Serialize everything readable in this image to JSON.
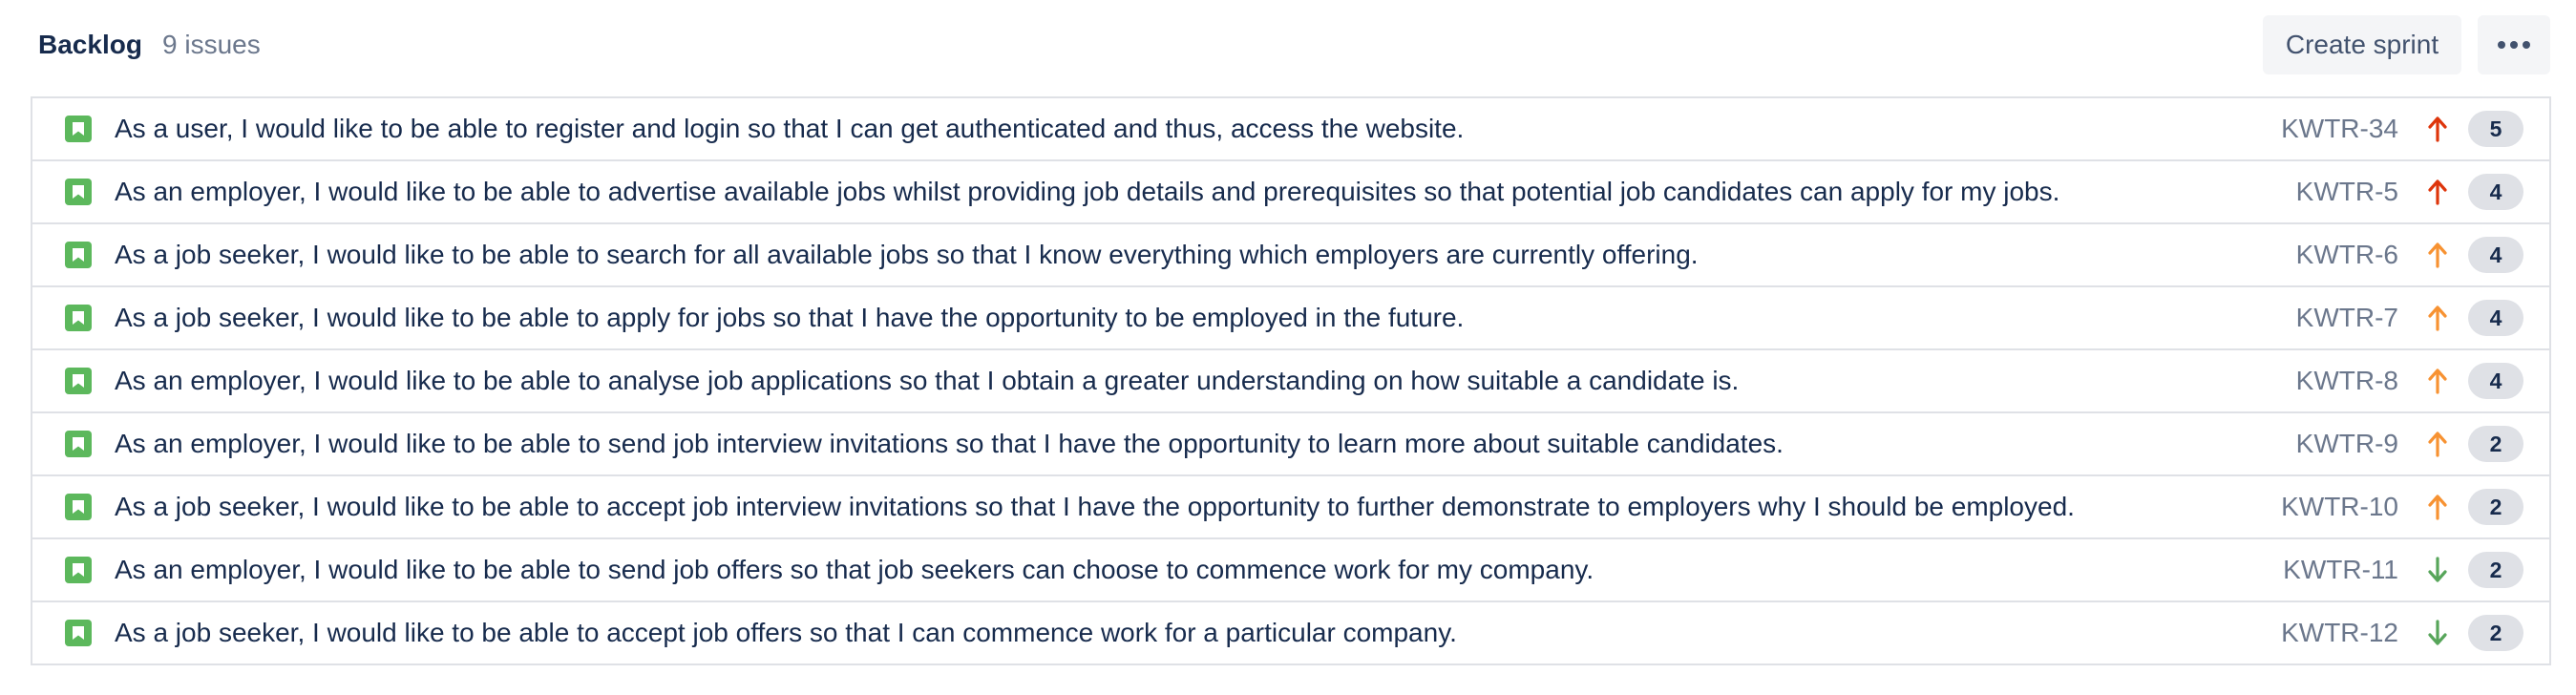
{
  "backlog": {
    "title": "Backlog",
    "count": "9 issues",
    "create_sprint_label": "Create sprint",
    "more_icon": "more-horizontal-icon"
  },
  "colors": {
    "story": "#5cb85c",
    "priority_highest": "#de350b",
    "priority_high": "#f79232",
    "priority_low": "#57a55a",
    "points_bg": "#dfe1e6"
  },
  "issues": [
    {
      "summary": "As a user, I would like to be able to register and login so that I can get authenticated and thus, access the website.",
      "key": "KWTR-34",
      "priority": "highest",
      "points": "5"
    },
    {
      "summary": "As an employer, I would like to be able to advertise available jobs whilst providing job details and prerequisites so that potential job candidates can apply for my jobs.",
      "key": "KWTR-5",
      "priority": "highest",
      "points": "4"
    },
    {
      "summary": "As a job seeker, I would like to be able to search for all available jobs so that I know everything which employers are currently offering.",
      "key": "KWTR-6",
      "priority": "high",
      "points": "4"
    },
    {
      "summary": "As a job seeker, I would like to be able to apply for jobs so that I have the opportunity to be employed in the future.",
      "key": "KWTR-7",
      "priority": "high",
      "points": "4"
    },
    {
      "summary": "As an employer, I would like to be able to analyse job applications so that I obtain a greater understanding on how suitable a candidate is.",
      "key": "KWTR-8",
      "priority": "high",
      "points": "4"
    },
    {
      "summary": "As an employer, I would like to be able to send job interview invitations so that I have the opportunity to learn more about suitable candidates.",
      "key": "KWTR-9",
      "priority": "high",
      "points": "2"
    },
    {
      "summary": "As a job seeker, I would like to be able to accept job interview invitations so that I have the opportunity to further demonstrate to employers why I should be employed.",
      "key": "KWTR-10",
      "priority": "high",
      "points": "2"
    },
    {
      "summary": "As an employer, I would like to be able to send job offers so that job seekers can choose to commence work for my company.",
      "key": "KWTR-11",
      "priority": "low",
      "points": "2"
    },
    {
      "summary": "As a job seeker, I would like to be able to accept job offers so that I can commence work for a particular company.",
      "key": "KWTR-12",
      "priority": "low",
      "points": "2"
    }
  ]
}
